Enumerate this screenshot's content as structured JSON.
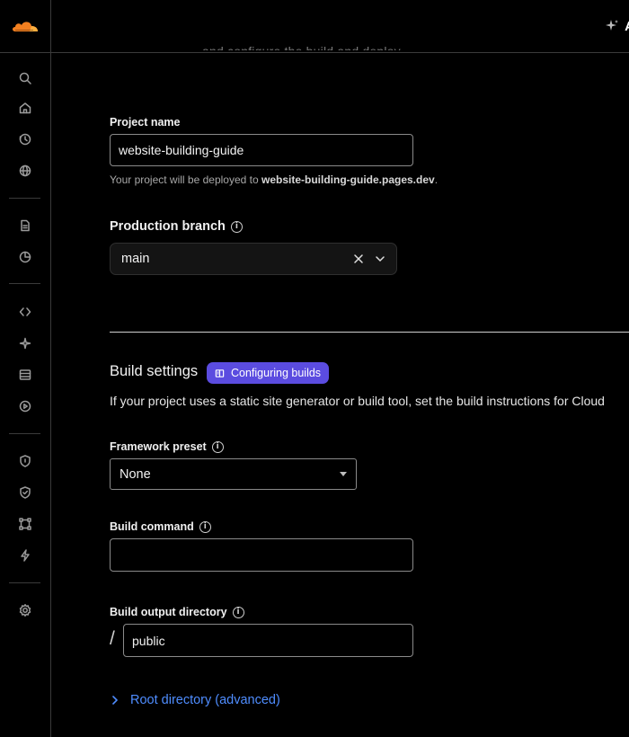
{
  "header": {
    "cut_off_text": "and configure the build and deploy",
    "action_label": "A"
  },
  "sidebar": {
    "icons": [
      "search-icon",
      "home-icon",
      "history-icon",
      "globe-icon",
      "document-icon",
      "analytics-icon",
      "code-icon",
      "sparkle-icon",
      "storage-icon",
      "media-icon",
      "shield-icon",
      "shield-check-icon",
      "network-icon",
      "lightning-icon",
      "gear-icon"
    ]
  },
  "form": {
    "project_name": {
      "label": "Project name",
      "value": "website-building-guide",
      "help_prefix": "Your project will be deployed to ",
      "help_domain": "website-building-guide.pages.dev",
      "help_suffix": "."
    },
    "production_branch": {
      "label": "Production branch",
      "value": "main"
    },
    "build_settings": {
      "title": "Build settings",
      "pill_label": "Configuring builds",
      "description": "If your project uses a static site generator or build tool, set the build instructions for Cloud"
    },
    "framework_preset": {
      "label": "Framework preset",
      "value": "None"
    },
    "build_command": {
      "label": "Build command",
      "value": ""
    },
    "build_output": {
      "label": "Build output directory",
      "prefix": "/",
      "value": "public"
    },
    "root_directory": {
      "label": "Root directory (advanced)"
    }
  },
  "colors": {
    "accent": "#5b4ce0",
    "link": "#4f8dff",
    "brand": "#f38020"
  }
}
